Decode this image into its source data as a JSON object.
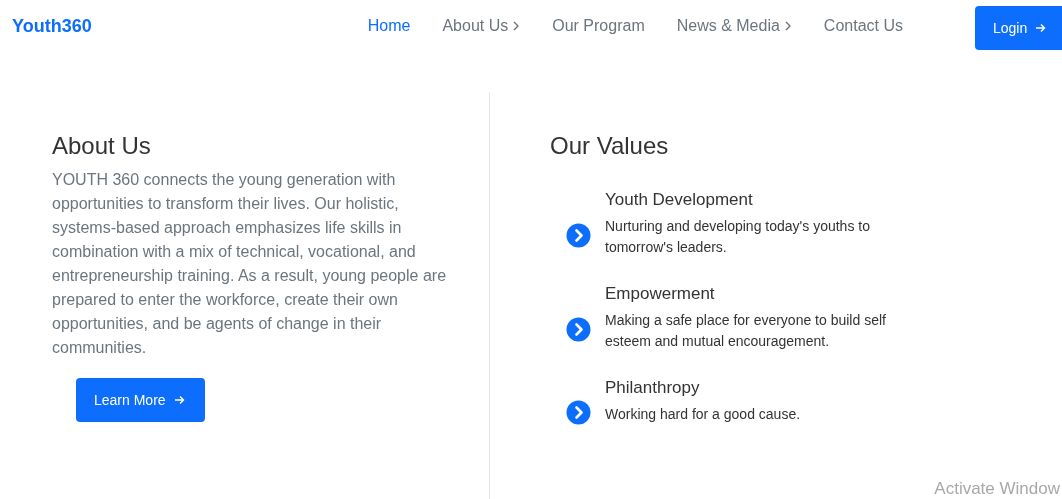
{
  "header": {
    "logo": "Youth360",
    "nav": [
      {
        "label": "Home",
        "selected": true,
        "has_submenu": false
      },
      {
        "label": "About Us",
        "selected": false,
        "has_submenu": true
      },
      {
        "label": "Our Program",
        "selected": false,
        "has_submenu": false
      },
      {
        "label": "News & Media",
        "selected": false,
        "has_submenu": true
      },
      {
        "label": "Contact Us",
        "selected": false,
        "has_submenu": false
      }
    ],
    "login_button": "Login"
  },
  "about": {
    "title": "About Us",
    "text": "YOUTH 360 connects the young generation with opportunities to transform their lives. Our holistic, systems-based approach emphasizes life skills in combination with a mix of technical, vocational, and entrepreneurship training. As a result, young people are prepared to enter the workforce, create their own opportunities, and be agents of change in their communities.",
    "button": "Learn More"
  },
  "values": {
    "title": "Our Values",
    "items": [
      {
        "title": "Youth Development",
        "text": "Nurturing and developing today's youths to tomorrow's leaders."
      },
      {
        "title": "Empowerment",
        "text": "Making a safe place for everyone to build self esteem and mutual encouragement."
      },
      {
        "title": "Philanthropy",
        "text": "Working hard for a good cause."
      }
    ]
  },
  "os_overlay": "Activate Window"
}
